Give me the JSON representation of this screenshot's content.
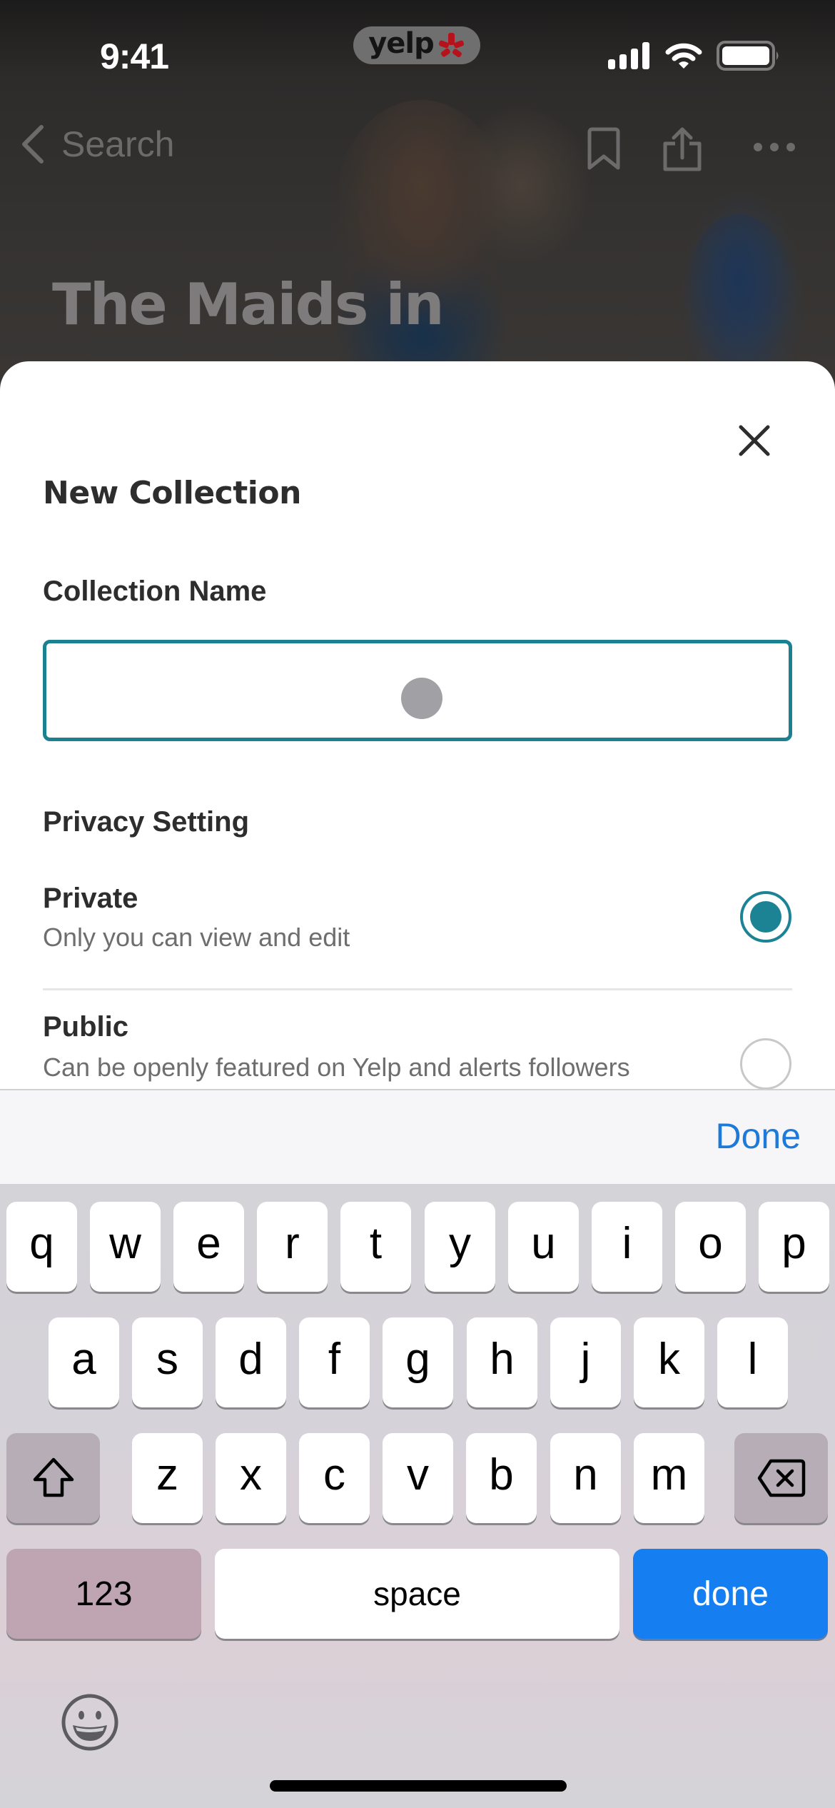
{
  "status_bar": {
    "time": "9:41",
    "app_badge": "yelp",
    "icons": [
      "cellular-signal-icon",
      "wifi-icon",
      "battery-icon"
    ]
  },
  "background_page": {
    "nav": {
      "back_label": "Search",
      "icons": [
        "chevron-left-icon",
        "bookmark-icon",
        "share-icon",
        "more-icon"
      ]
    },
    "business_title": "The Maids in"
  },
  "sheet": {
    "title": "New Collection",
    "close_icon": "close-icon",
    "name_field": {
      "label": "Collection Name",
      "value": "",
      "placeholder": ""
    },
    "privacy": {
      "label": "Privacy Setting",
      "options": [
        {
          "title": "Private",
          "description": "Only you can view and edit",
          "selected": true
        },
        {
          "title": "Public",
          "description": "Can be openly featured on Yelp and alerts followers",
          "selected": false
        }
      ]
    },
    "accent_color": "#1b8394"
  },
  "keyboard": {
    "accessory_done": "Done",
    "rows": [
      [
        "q",
        "w",
        "e",
        "r",
        "t",
        "y",
        "u",
        "i",
        "o",
        "p"
      ],
      [
        "a",
        "s",
        "d",
        "f",
        "g",
        "h",
        "j",
        "k",
        "l"
      ],
      [
        "z",
        "x",
        "c",
        "v",
        "b",
        "n",
        "m"
      ]
    ],
    "numbers_key": "123",
    "space_key": "space",
    "return_key": "done",
    "return_key_color": "#157ef0",
    "shift_icon": "shift-icon",
    "delete_icon": "backspace-icon",
    "emoji_icon": "emoji-icon"
  }
}
